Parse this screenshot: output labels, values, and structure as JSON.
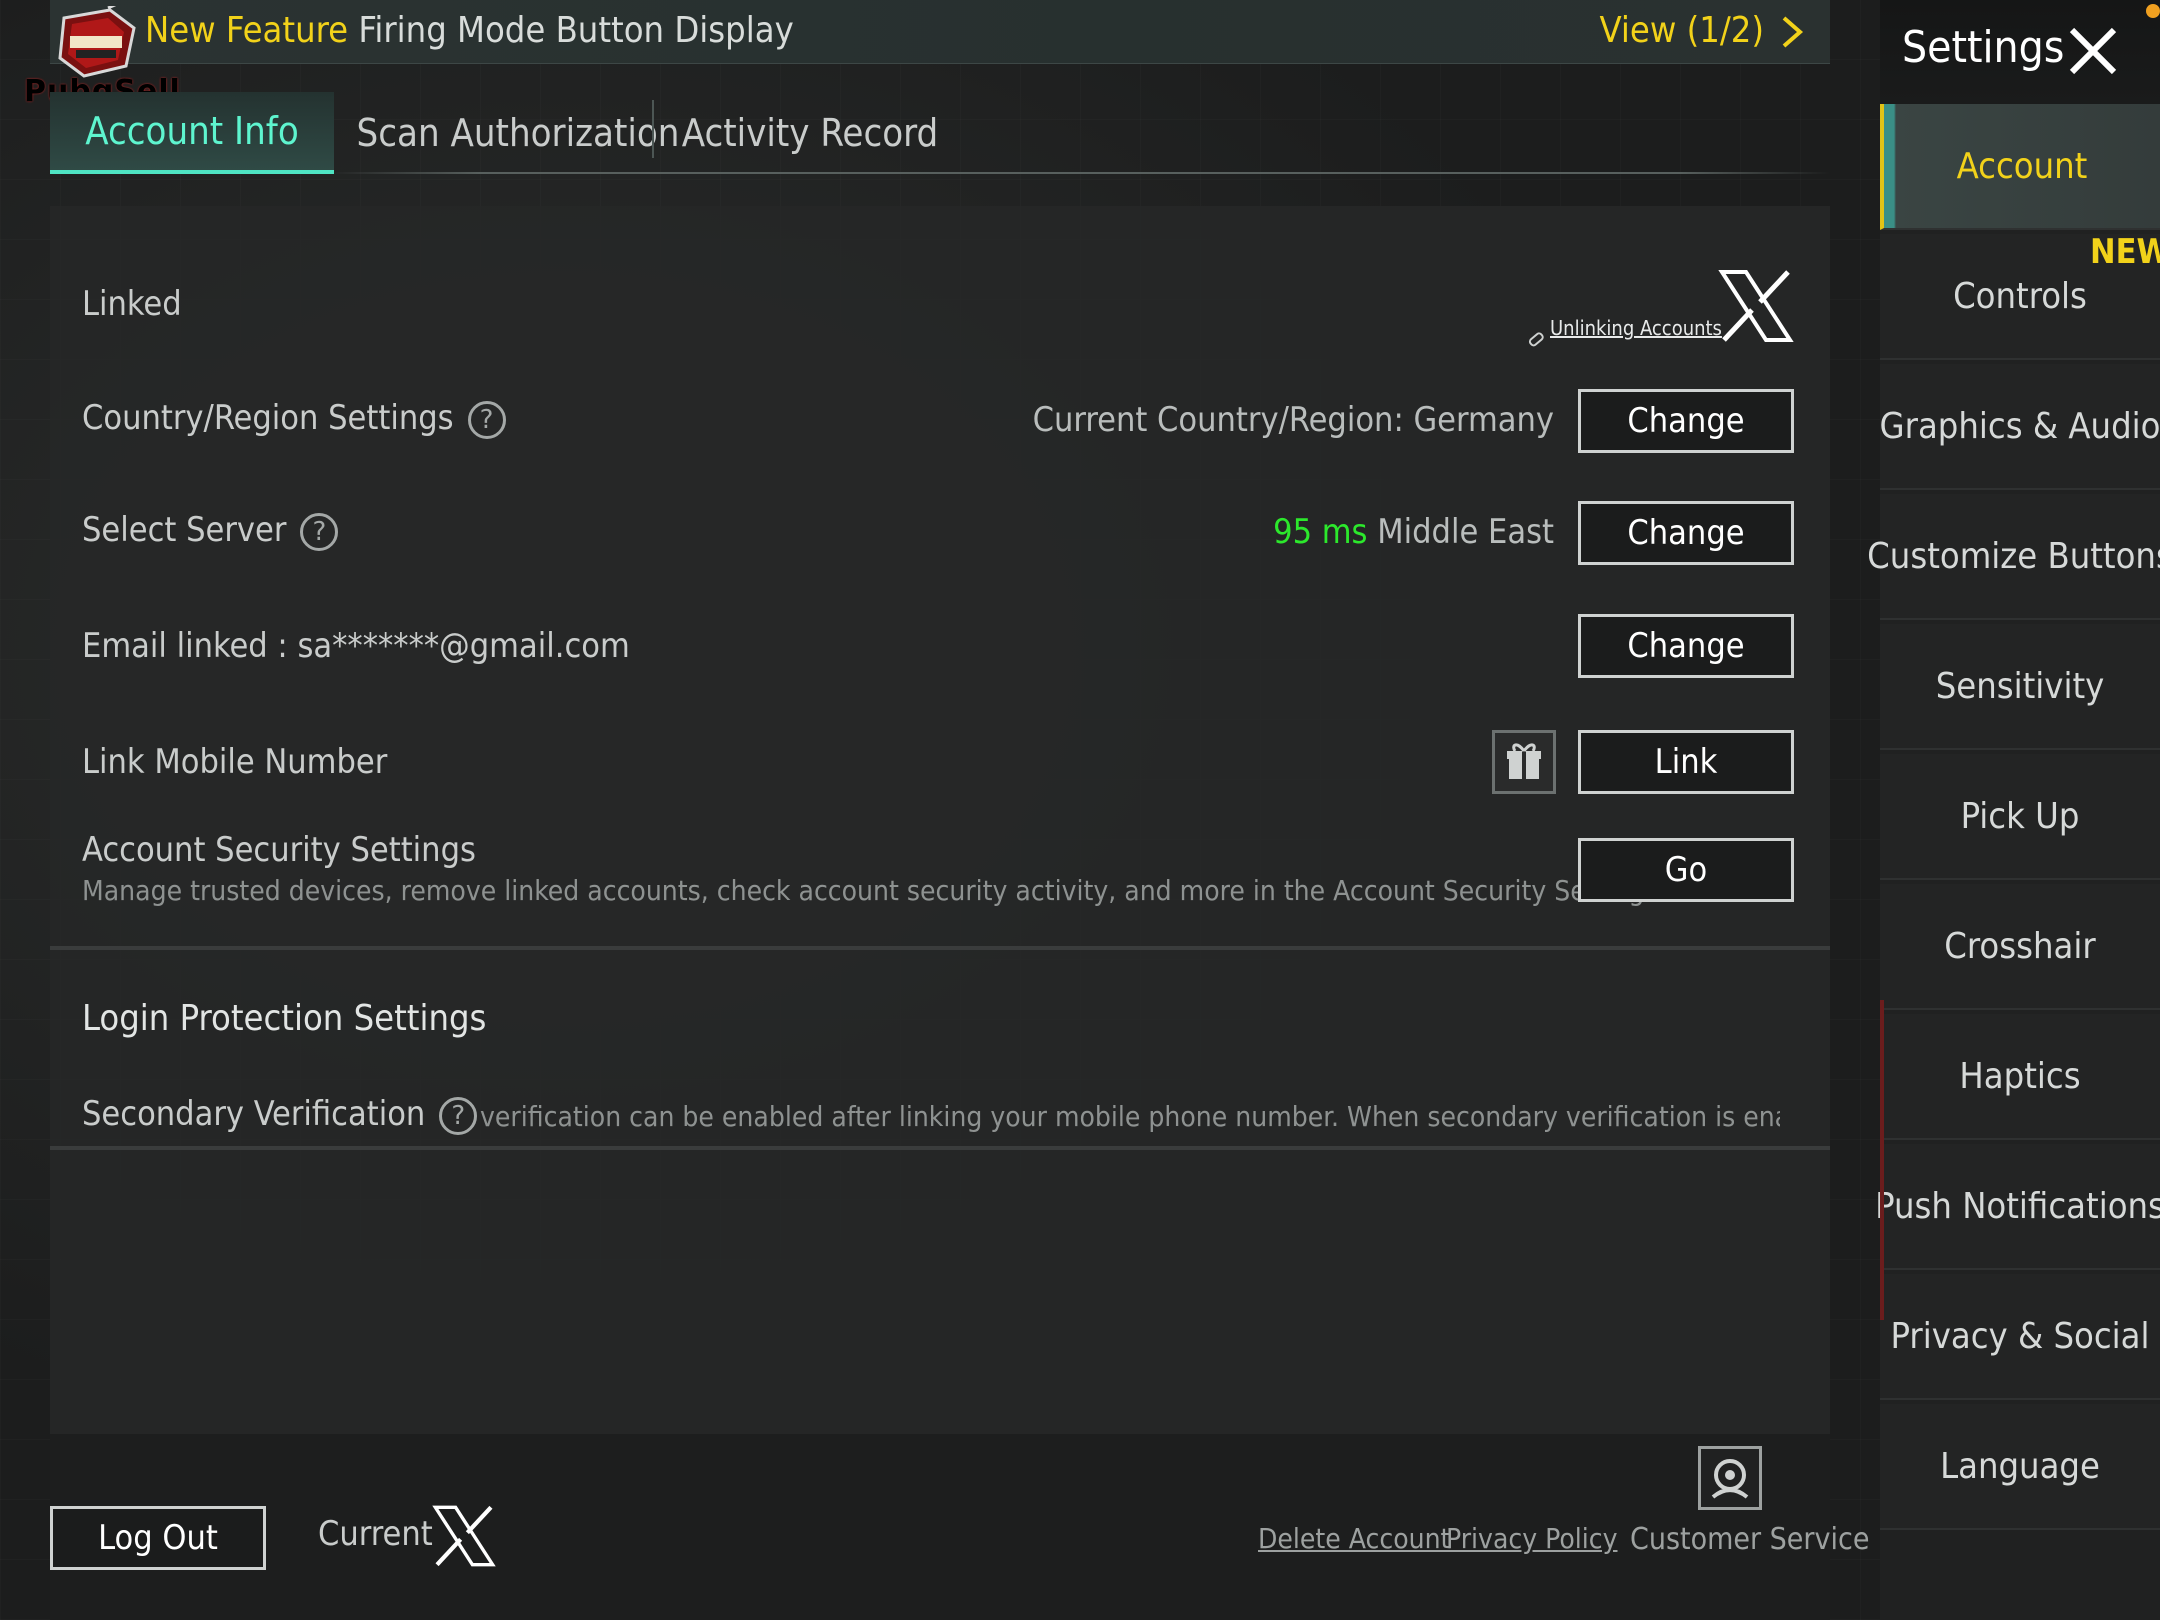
{
  "banner": {
    "highlight": "New Feature",
    "title": "Firing Mode Button Display",
    "view": "View (1/2)"
  },
  "logo": {
    "text": "PubgSell"
  },
  "tabs": [
    {
      "label": "Account Info",
      "active": true
    },
    {
      "label": "Scan Authorization",
      "active": false
    },
    {
      "label": "Activity Record",
      "active": false
    }
  ],
  "account": {
    "linked_label": "Linked",
    "unlinking_label": "Unlinking Accounts",
    "country_label": "Country/Region Settings",
    "country_value": "Current Country/Region: Germany",
    "country_button": "Change",
    "server_label": "Select Server",
    "server_ping": "95 ms",
    "server_region": "Middle East",
    "server_button": "Change",
    "email_label": "Email linked : sa*******@gmail.com",
    "email_button": "Change",
    "mobile_label": "Link Mobile Number",
    "mobile_button": "Link",
    "security_label": "Account Security Settings",
    "security_desc": "Manage trusted devices, remove linked accounts, check account security activity, and more in the Account Security Settings.",
    "security_button": "Go"
  },
  "login_protection": {
    "title": "Login Protection Settings",
    "secondary_label": "Secondary Verification",
    "secondary_desc": "verification can be enabled after linking your mobile phone number. When secondary verification is enabled, non-trusted c"
  },
  "footer": {
    "logout": "Log Out",
    "current": "Current",
    "delete_account": "Delete Account",
    "privacy_policy": "Privacy Policy",
    "customer_service": "Customer Service"
  },
  "sidebar": {
    "title": "Settings",
    "new_badge": "NEW",
    "items": [
      {
        "label": "Account",
        "active": true
      },
      {
        "label": "Controls",
        "active": false
      },
      {
        "label": "Graphics & Audio",
        "active": false
      },
      {
        "label": "Customize Buttons",
        "active": false
      },
      {
        "label": "Sensitivity",
        "active": false
      },
      {
        "label": "Pick Up",
        "active": false
      },
      {
        "label": "Crosshair",
        "active": false
      },
      {
        "label": "Haptics",
        "active": false
      },
      {
        "label": "Push Notifications",
        "active": false
      },
      {
        "label": "Privacy & Social",
        "active": false
      },
      {
        "label": "Language",
        "active": false
      }
    ]
  },
  "colors": {
    "accent_yellow": "#f2d21a",
    "accent_teal": "#5ef5cf",
    "ping_green": "#2ce82c"
  }
}
